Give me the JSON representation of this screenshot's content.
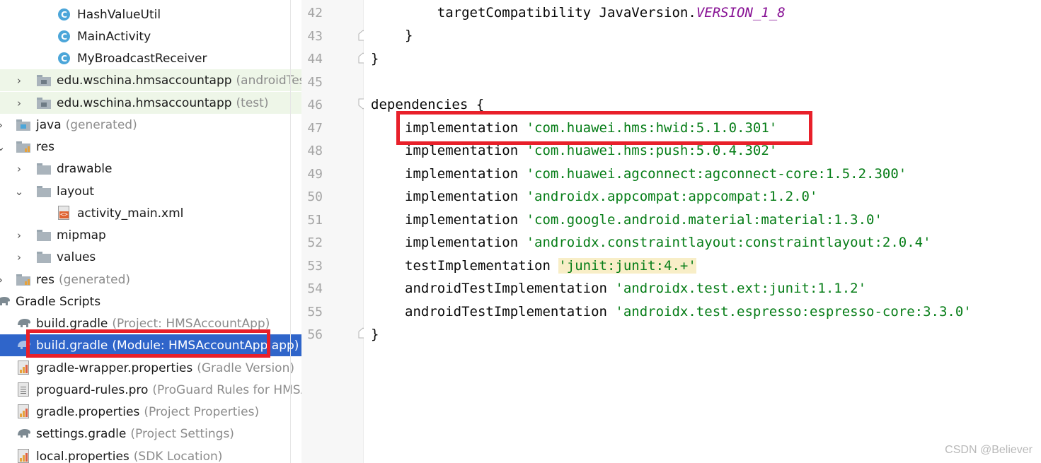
{
  "tree": [
    {
      "label": "HashValueUtil",
      "sub": "",
      "icon": "class-icon"
    },
    {
      "label": "MainActivity",
      "sub": "",
      "icon": "class-icon"
    },
    {
      "label": "MyBroadcastReceiver",
      "sub": "",
      "icon": "class-icon"
    },
    {
      "label": "edu.wschina.hmsaccountapp",
      "sub": "(androidTest)",
      "icon": "package-folder-icon"
    },
    {
      "label": "edu.wschina.hmsaccountapp",
      "sub": "(test)",
      "icon": "package-folder-icon"
    },
    {
      "label": "java",
      "sub": "(generated)",
      "icon": "generated-folder-icon"
    },
    {
      "label": "res",
      "sub": "",
      "icon": "resource-folder-icon"
    },
    {
      "label": "drawable",
      "sub": "",
      "icon": "folder-icon"
    },
    {
      "label": "layout",
      "sub": "",
      "icon": "folder-icon"
    },
    {
      "label": "activity_main.xml",
      "sub": "",
      "icon": "xml-file-icon"
    },
    {
      "label": "mipmap",
      "sub": "",
      "icon": "folder-icon"
    },
    {
      "label": "values",
      "sub": "",
      "icon": "folder-icon"
    },
    {
      "label": "res",
      "sub": "(generated)",
      "icon": "resource-folder-icon"
    },
    {
      "label": "Gradle Scripts",
      "sub": "",
      "icon": "gradle-icon"
    },
    {
      "label": "build.gradle",
      "sub": "(Project: HMSAccountApp)",
      "icon": "gradle-icon"
    },
    {
      "label": "build.gradle",
      "sub": "(Module: HMSAccountApp.app)",
      "icon": "gradle-icon"
    },
    {
      "label": "gradle-wrapper.properties",
      "sub": "(Gradle Version)",
      "icon": "properties-file-icon"
    },
    {
      "label": "proguard-rules.pro",
      "sub": "(ProGuard Rules for HMSA",
      "icon": "text-file-icon"
    },
    {
      "label": "gradle.properties",
      "sub": "(Project Properties)",
      "icon": "properties-file-icon"
    },
    {
      "label": "settings.gradle",
      "sub": "(Project Settings)",
      "icon": "gradle-icon"
    },
    {
      "label": "local.properties",
      "sub": "(SDK Location)",
      "icon": "properties-file-icon"
    }
  ],
  "editor": {
    "lines": [
      {
        "num": "42",
        "code": "    targetCompatibility JavaVersion.",
        "const": "VERSION_1_8",
        "str": ""
      },
      {
        "num": "43",
        "code": "}",
        "const": "",
        "str": ""
      },
      {
        "num": "44",
        "code": "}",
        "const": "",
        "str": ""
      },
      {
        "num": "45",
        "code": "",
        "const": "",
        "str": ""
      },
      {
        "num": "46",
        "code": "dependencies {",
        "const": "",
        "str": ""
      },
      {
        "num": "47",
        "code": "implementation ",
        "const": "",
        "str": "'com.huawei.hms:hwid:5.1.0.301'"
      },
      {
        "num": "48",
        "code": "implementation ",
        "const": "",
        "str": "'com.huawei.hms:push:5.0.4.302'"
      },
      {
        "num": "49",
        "code": "implementation ",
        "const": "",
        "str": "'com.huawei.agconnect:agconnect-core:1.5.2.300'"
      },
      {
        "num": "50",
        "code": "implementation ",
        "const": "",
        "str": "'androidx.appcompat:appcompat:1.2.0'"
      },
      {
        "num": "51",
        "code": "implementation ",
        "const": "",
        "str": "'com.google.android.material:material:1.3.0'"
      },
      {
        "num": "52",
        "code": "implementation ",
        "const": "",
        "str": "'androidx.constraintlayout:constraintlayout:2.0.4'"
      },
      {
        "num": "53",
        "code": "testImplementation ",
        "const": "",
        "str": "'junit:junit:4.+'"
      },
      {
        "num": "54",
        "code": "androidTestImplementation ",
        "const": "",
        "str": "'androidx.test.ext:junit:1.1.2'"
      },
      {
        "num": "55",
        "code": "androidTestImplementation ",
        "const": "",
        "str": "'androidx.test.espresso:espresso-core:3.3.0'"
      },
      {
        "num": "56",
        "code": "}",
        "const": "",
        "str": ""
      }
    ]
  },
  "watermark": "CSDN @Believer",
  "colors": {
    "selection": "#2f65ca",
    "annotation_box": "#e8202a",
    "string": "#067d17",
    "constant": "#871094"
  }
}
